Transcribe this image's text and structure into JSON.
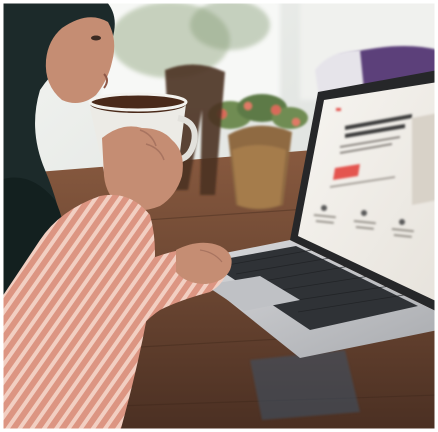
{
  "photo": {
    "description_icon": "photo-icon",
    "colors": {
      "wall": "#e9ece9",
      "table": "#6b4632",
      "table_dark": "#4a2f22",
      "laptop_body": "#c9cbcf",
      "laptop_screen_bg": "#f4f2ee",
      "keyboard": "#2f3236",
      "hijab": "#1c2a2a",
      "skin": "#c58d73",
      "sleeve": "#e3a28c",
      "sleeve_stripe": "#f3d8cc",
      "mug": "#ecebe6",
      "coffee": "#4a2a1a",
      "plant_pot": "#a57c4b",
      "plant_green": "#5d7a46",
      "accent_red": "#e4544f"
    }
  },
  "screen": {
    "headline": "",
    "cta_label": ""
  }
}
